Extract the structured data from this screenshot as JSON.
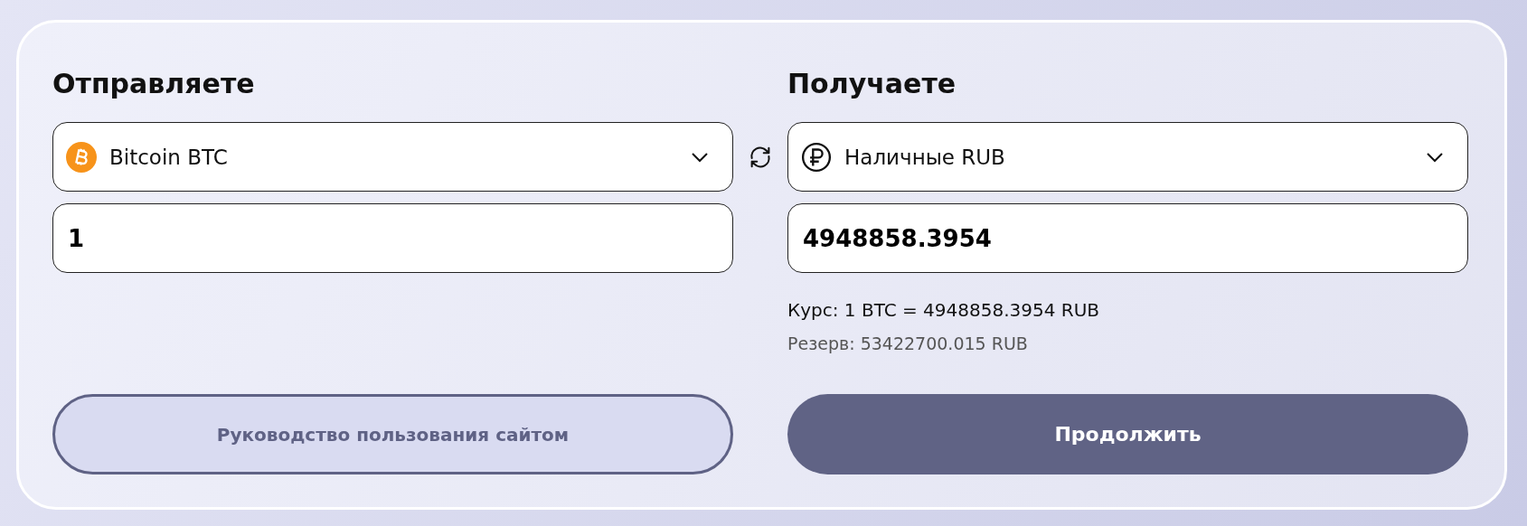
{
  "send": {
    "title": "Отправляете",
    "currency": "Bitcoin BTC",
    "amount": "1"
  },
  "receive": {
    "title": "Получаете",
    "currency": "Наличные RUB",
    "amount": "4948858.3954"
  },
  "rate": "Курс: 1 BTC = 4948858.3954 RUB",
  "reserve": "Резерв: 53422700.015 RUB",
  "buttons": {
    "guide": "Руководство пользования сайтом",
    "continue": "Продолжить"
  }
}
